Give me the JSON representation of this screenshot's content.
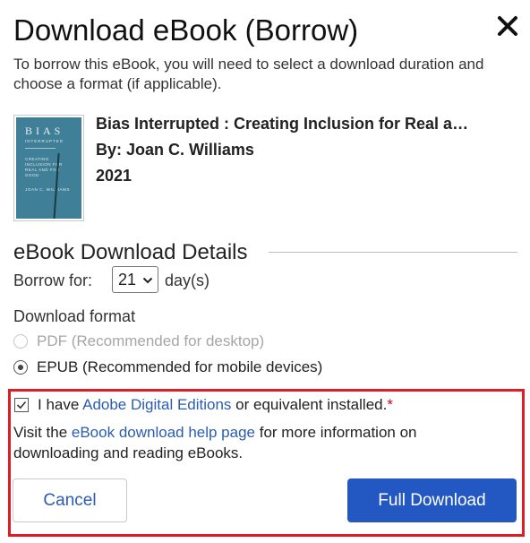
{
  "dialog": {
    "title": "Download eBook (Borrow)",
    "intro": "To borrow this eBook, you will need to select a download duration and choose a format (if applicable)."
  },
  "book": {
    "title": "Bias Interrupted : Creating Inclusion for Real a…",
    "author": "By: Joan C. Williams",
    "year": "2021",
    "cover": {
      "title": "BIAS",
      "subtitle": "INTERRUPTED",
      "tagline": "CREATING INCLUSION FOR REAL AND FOR GOOD",
      "author": "JOAN C. WILLIAMS",
      "color": "#3f7f97"
    }
  },
  "details": {
    "section_title": "eBook Download Details",
    "borrow_label": "Borrow for:",
    "borrow_value": "21",
    "days_label": "day(s)",
    "format_label": "Download format",
    "formats": [
      {
        "label": "PDF (Recommended for desktop)",
        "checked": false,
        "disabled": true
      },
      {
        "label": "EPUB (Recommended for mobile devices)",
        "checked": true,
        "disabled": false
      }
    ]
  },
  "consent": {
    "prefix": "I have ",
    "link": "Adobe Digital Editions",
    "suffix": " or equivalent installed.",
    "required_mark": "*",
    "checked": true
  },
  "help": {
    "prefix": "Visit the ",
    "link": "eBook download help page",
    "suffix": " for more information on downloading and reading eBooks."
  },
  "actions": {
    "cancel": "Cancel",
    "full_download": "Full Download"
  },
  "icons": {
    "close": "close-icon",
    "dropdown": "chevron-down-icon",
    "checkbox": "checkbox-checked-icon"
  },
  "colors": {
    "primary": "#2358c2",
    "link": "#2a5db0",
    "highlight": "#e01d25"
  }
}
